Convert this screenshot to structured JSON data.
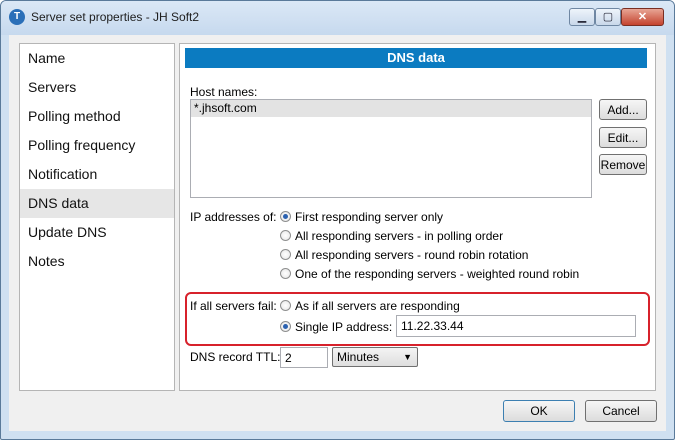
{
  "window": {
    "title": "Server set properties - JH Soft2",
    "min_label": "▁",
    "max_label": "▢",
    "close_label": "✕"
  },
  "nav": {
    "items": [
      {
        "label": "Name"
      },
      {
        "label": "Servers"
      },
      {
        "label": "Polling method"
      },
      {
        "label": "Polling frequency"
      },
      {
        "label": "Notification"
      },
      {
        "label": "DNS data",
        "selected": true
      },
      {
        "label": "Update DNS"
      },
      {
        "label": "Notes"
      }
    ]
  },
  "panel": {
    "header": "DNS data",
    "host_names_label": "Host names:",
    "host_names": [
      "*.jhsoft.com"
    ],
    "buttons": {
      "add": "Add...",
      "edit": "Edit...",
      "remove": "Remove"
    },
    "ip_addresses_label": "IP addresses of:",
    "ip_options": [
      {
        "label": "First responding server only",
        "selected": true
      },
      {
        "label": "All responding servers - in polling order",
        "selected": false
      },
      {
        "label": "All responding servers - round robin rotation",
        "selected": false
      },
      {
        "label": "One of the responding servers - weighted round robin",
        "selected": false
      }
    ],
    "fail_label": "If all servers fail:",
    "fail_options": [
      {
        "label": "As if all servers are responding",
        "selected": false
      },
      {
        "label": "Single IP address:",
        "selected": true
      }
    ],
    "single_ip_value": "11.22.33.44",
    "ttl_label": "DNS record TTL:",
    "ttl_value": "2",
    "ttl_unit": "Minutes"
  },
  "footer": {
    "ok": "OK",
    "cancel": "Cancel"
  },
  "colors": {
    "header_bg": "#0b7bc1",
    "highlight": "#d7212b"
  }
}
